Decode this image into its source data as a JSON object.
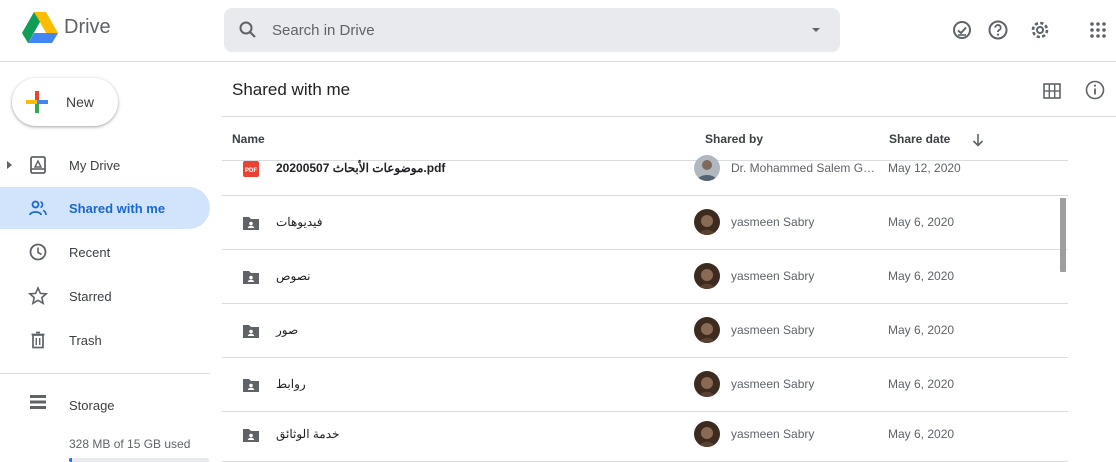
{
  "app": {
    "brand": "Drive"
  },
  "search": {
    "placeholder": "Search in Drive"
  },
  "header_icons": [
    "offline-check-icon",
    "help-icon",
    "settings-icon",
    "apps-grid-icon"
  ],
  "sidebar": {
    "new_label": "New",
    "items": [
      {
        "label": "My Drive",
        "icon": "my-drive-icon",
        "active": false
      },
      {
        "label": "Shared with me",
        "icon": "shared-people-icon",
        "active": true
      },
      {
        "label": "Recent",
        "icon": "clock-icon",
        "active": false
      },
      {
        "label": "Starred",
        "icon": "star-icon",
        "active": false
      },
      {
        "label": "Trash",
        "icon": "trash-icon",
        "active": false
      }
    ],
    "storage": {
      "label": "Storage",
      "used_text": "328 MB of 15 GB used",
      "used_fraction": 0.021
    }
  },
  "main": {
    "title": "Shared with me",
    "columns": {
      "name": "Name",
      "shared_by": "Shared by",
      "share_date": "Share date"
    },
    "rows": [
      {
        "name": "20200507 موضوعات الأبحاث.pdf",
        "type": "pdf",
        "shared_by": "Dr. Mohammed Salem Ghoneim",
        "date": "May 12, 2020"
      },
      {
        "name": "فيديوهات",
        "type": "shared-folder",
        "shared_by": "yasmeen Sabry",
        "date": "May 6, 2020"
      },
      {
        "name": "نصوص",
        "type": "shared-folder",
        "shared_by": "yasmeen Sabry",
        "date": "May 6, 2020"
      },
      {
        "name": "صور",
        "type": "shared-folder",
        "shared_by": "yasmeen Sabry",
        "date": "May 6, 2020"
      },
      {
        "name": "روابط",
        "type": "shared-folder",
        "shared_by": "yasmeen Sabry",
        "date": "May 6, 2020"
      },
      {
        "name": "خدمة الوثائق",
        "type": "shared-folder",
        "shared_by": "yasmeen Sabry",
        "date": "May 6, 2020"
      }
    ]
  },
  "colors": {
    "accent": "#1a73e8",
    "active_bg": "#d2e3fc",
    "pdf_red": "#ea4335",
    "folder_gray": "#5f6368"
  }
}
